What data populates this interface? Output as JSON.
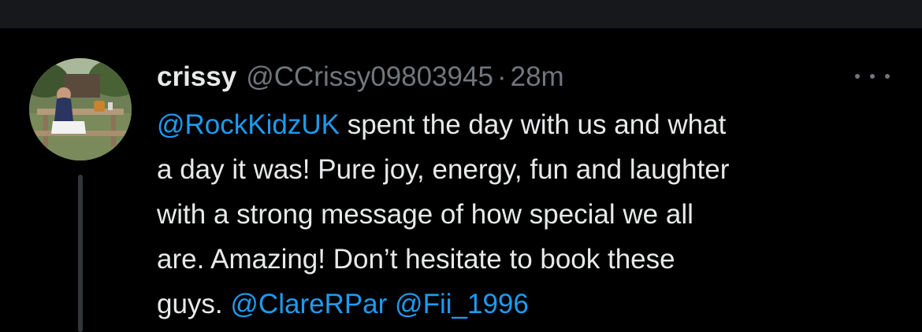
{
  "tweet": {
    "display_name": "crissy",
    "handle": "@CCrissy09803945",
    "separator": "·",
    "time": "28m",
    "more_icon": "more-horizontal-icon",
    "lines": [
      {
        "mention": "@RockKidzUK",
        "text": " spent the day with us and what"
      },
      {
        "text": "a day it was! Pure joy, energy, fun and laughter"
      },
      {
        "text": "with a strong message of how special we all"
      },
      {
        "text": "are. Amazing! Don’t hesitate to book these"
      },
      {
        "text": "guys. ",
        "mention1": "@ClareRPar",
        "space": " ",
        "mention2": "@Fii_1996"
      }
    ]
  },
  "colors": {
    "background": "#000000",
    "text": "#e7e9ea",
    "secondary": "#71767b",
    "link": "#1d9bf0",
    "thread_line": "#333639"
  }
}
